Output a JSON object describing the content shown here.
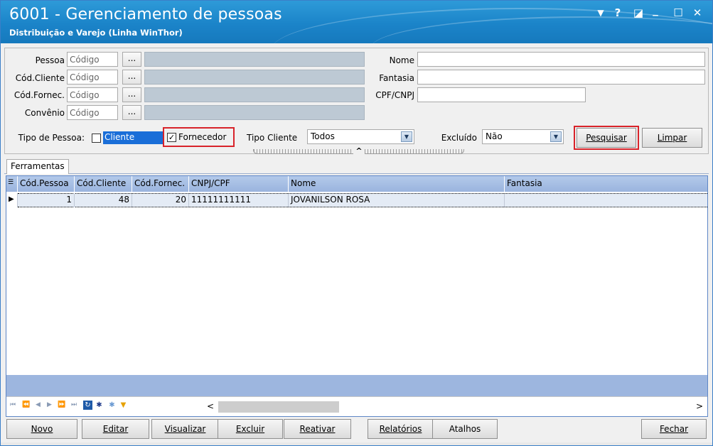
{
  "window": {
    "title": "6001 - Gerenciamento de pessoas",
    "subtitle": "Distribuição e Varejo (Linha WinThor)",
    "controls": [
      "▼",
      "?",
      "◪",
      "_",
      "☐",
      "✕"
    ]
  },
  "form": {
    "labels": {
      "pessoa": "Pessoa",
      "cod_cliente": "Cód.Cliente",
      "cod_fornec": "Cód.Fornec.",
      "convenio": "Convênio",
      "nome": "Nome",
      "fantasia": "Fantasia",
      "cpf_cnpj": "CPF/CNPJ",
      "tipo_pessoa": "Tipo de Pessoa:",
      "tipo_cliente": "Tipo Cliente",
      "excluido": "Excluído"
    },
    "placeholder_codigo": "Código",
    "dots": "...",
    "chk_cliente": {
      "label": "Cliente",
      "checked": false
    },
    "chk_fornecedor": {
      "label": "Fornecedor",
      "checked": true
    },
    "tipo_cliente_value": "Todos",
    "excluido_value": "Não",
    "pesquisar": "Pesquisar",
    "limpar": "Limpar",
    "collapse_glyph": "^"
  },
  "tabs": {
    "ferramentas": "Ferramentas"
  },
  "grid": {
    "columns": [
      "Cód.Pessoa",
      "Cód.Cliente",
      "Cód.Fornec.",
      "CNPJ/CPF",
      "Nome",
      "Fantasia"
    ],
    "rows": [
      {
        "cod_pessoa": "1",
        "cod_cliente": "48",
        "cod_fornec": "20",
        "cnpj_cpf": "11111111111",
        "nome": "JOVANILSON ROSA",
        "fantasia": ""
      }
    ],
    "row_indicator": "▶",
    "nav": [
      "⏮",
      "⏪",
      "◀",
      "▶",
      "⏩",
      "⏭"
    ],
    "scroll_left": "<",
    "scroll_right": ">"
  },
  "buttons": {
    "novo": "Novo",
    "editar": "Editar",
    "visualizar": "Visualizar",
    "excluir": "Excluir",
    "reativar": "Reativar",
    "relatorios": "Relatórios",
    "atalhos": "Atalhos",
    "fechar": "Fechar"
  },
  "colors": {
    "titlebar": "#1b84c9",
    "highlight_red": "#d8232a",
    "selection_blue": "#1a6ed8"
  }
}
